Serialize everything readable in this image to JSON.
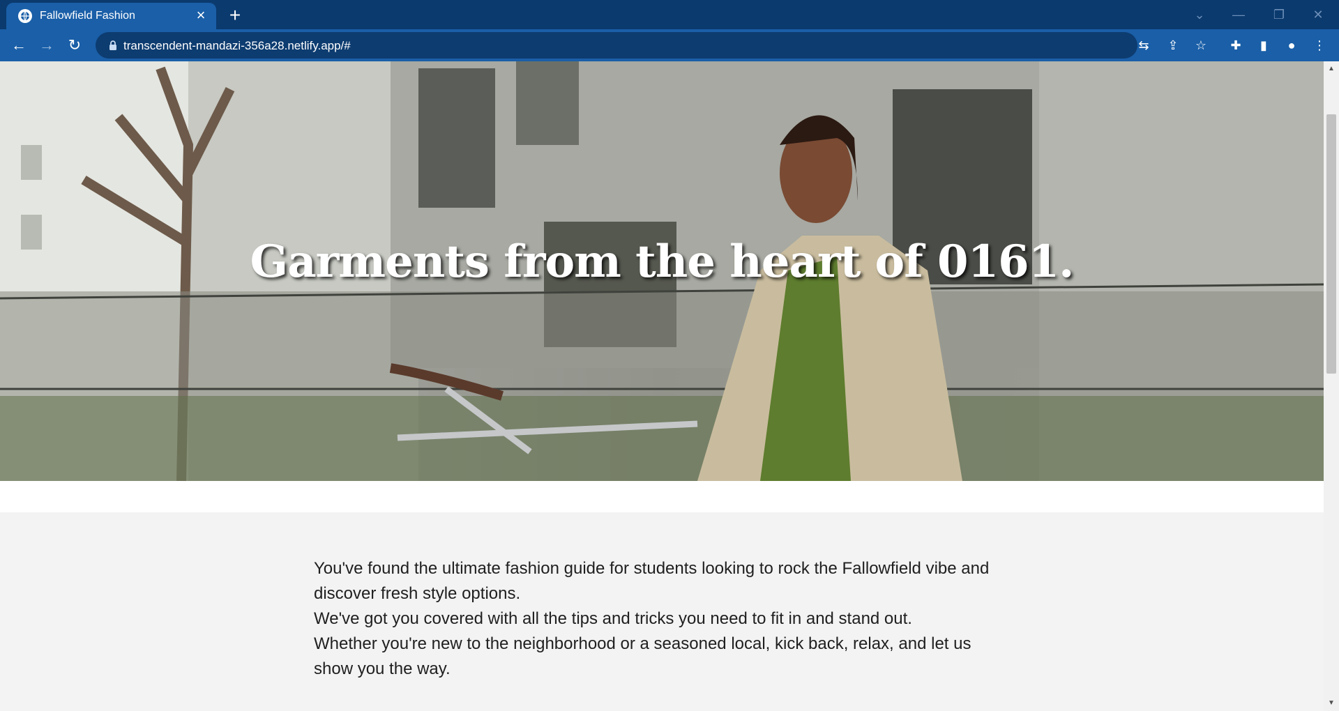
{
  "browser": {
    "tab_title": "Fallowfield Fashion",
    "tab_close": "×",
    "new_tab": "+",
    "url": "transcendent-mandazi-356a28.netlify.app/#",
    "controls": {
      "tab_search": "⌄",
      "minimize": "—",
      "restore": "❐",
      "close": "✕"
    },
    "nav": {
      "back": "←",
      "forward": "→",
      "reload": "↻"
    },
    "icons": {
      "translate": "⇆",
      "share": "⇪",
      "bookmark": "☆",
      "extensions": "✚",
      "side_panel": "▮",
      "profile": "●",
      "menu": "⋮"
    }
  },
  "hero": {
    "title": "Garments from the heart of 0161."
  },
  "intro": {
    "paragraphs": [
      "You've found the ultimate fashion guide for students looking to rock the Fallowfield vibe and discover fresh style options.",
      "We've got you covered with all the tips and tricks you need to fit in and stand out.",
      "Whether you're new to the neighborhood or a seasoned local, kick back, relax, and let us show you the way."
    ]
  },
  "scrollbar": {
    "up": "▲",
    "down": "▼"
  },
  "colors": {
    "tabstrip": "#0b3a6e",
    "toolbar": "#1a5fa8",
    "omnibox": "#0d3c70",
    "page_bg": "#f3f3f3"
  }
}
